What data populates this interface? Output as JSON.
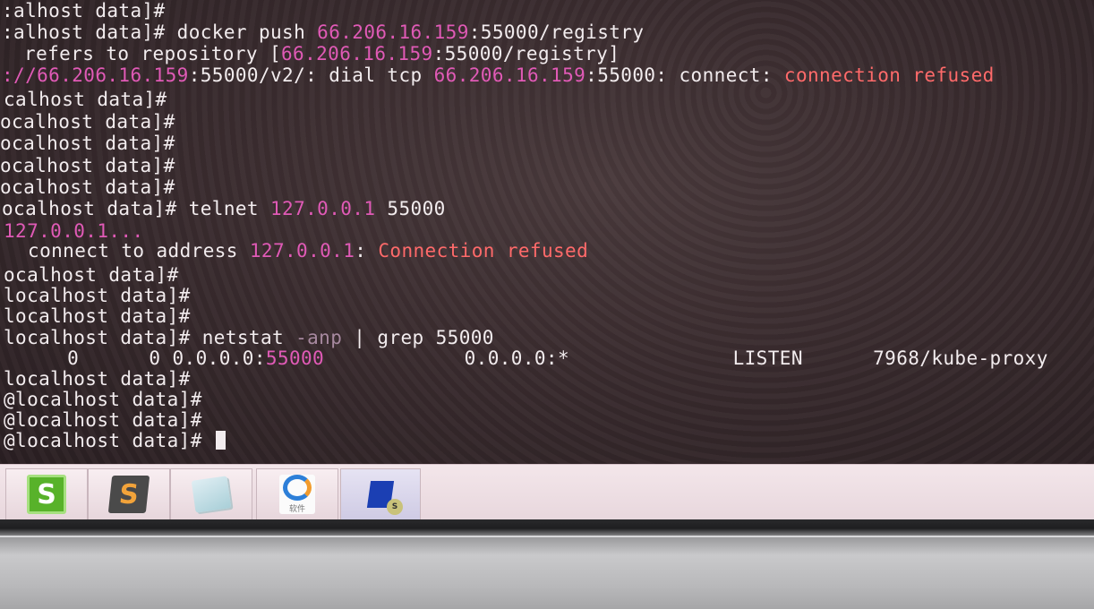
{
  "terminal": {
    "lines": [
      [
        {
          "t": ":alhost data]#",
          "c": ""
        }
      ],
      [
        {
          "t": ":alhost data]# docker push ",
          "c": ""
        },
        {
          "t": "66.206.16.159",
          "c": "mag"
        },
        {
          "t": ":55000/registry",
          "c": ""
        }
      ],
      [
        {
          "t": " refers to repository [",
          "c": ""
        },
        {
          "t": "66.206.16.159",
          "c": "mag"
        },
        {
          "t": ":55000/registry]",
          "c": ""
        }
      ],
      [
        {
          "t": "://66.206.16.159",
          "c": "mag"
        },
        {
          "t": ":55000/v2/: dial tcp ",
          "c": ""
        },
        {
          "t": "66.206.16.159",
          "c": "mag"
        },
        {
          "t": ":55000: connect: ",
          "c": ""
        },
        {
          "t": "connection refused",
          "c": "red"
        }
      ],
      [
        {
          "t": "calhost data]#",
          "c": ""
        }
      ],
      [
        {
          "t": "ocalhost data]#",
          "c": ""
        }
      ],
      [
        {
          "t": "ocalhost data]#",
          "c": ""
        }
      ],
      [
        {
          "t": "ocalhost data]#",
          "c": ""
        }
      ],
      [
        {
          "t": "ocalhost data]#",
          "c": ""
        }
      ],
      [
        {
          "t": "ocalhost data]# telnet ",
          "c": ""
        },
        {
          "t": "127.0.0.1",
          "c": "mag"
        },
        {
          "t": " 55000",
          "c": ""
        }
      ],
      [
        {
          "t": "127.0.0.1...",
          "c": "mag"
        }
      ],
      [
        {
          "t": " connect to address ",
          "c": ""
        },
        {
          "t": "127.0.0.1",
          "c": "mag"
        },
        {
          "t": ": ",
          "c": ""
        },
        {
          "t": "Connection refused",
          "c": "red"
        }
      ],
      [
        {
          "t": "ocalhost data]#",
          "c": ""
        }
      ],
      [
        {
          "t": "localhost data]#",
          "c": ""
        }
      ],
      [
        {
          "t": "localhost data]#",
          "c": ""
        }
      ],
      [
        {
          "t": "localhost data]# netstat ",
          "c": ""
        },
        {
          "t": "-anp",
          "c": "dim"
        },
        {
          "t": " | grep 55000",
          "c": ""
        }
      ],
      [
        {
          "t": "   0      0 0.0.0.0:",
          "c": ""
        },
        {
          "t": "55000",
          "c": "mag"
        },
        {
          "t": "            0.0.0.0:*              LISTEN      7968/kube-proxy",
          "c": ""
        }
      ],
      [
        {
          "t": "localhost data]#",
          "c": ""
        }
      ],
      [
        {
          "t": "@localhost data]#",
          "c": ""
        }
      ],
      [
        {
          "t": "@localhost data]#",
          "c": ""
        }
      ],
      [
        {
          "t": "@localhost data]# ",
          "c": ""
        }
      ]
    ]
  },
  "taskbar": {
    "items": [
      {
        "name": "green-s-app-icon",
        "glyph": "S"
      },
      {
        "name": "sublime-text-icon",
        "glyph": "S"
      },
      {
        "name": "notes-app-icon",
        "glyph": ""
      },
      {
        "name": "app-shortcut-icon",
        "glyph": "",
        "caption": "软件"
      },
      {
        "name": "ssh-client-icon",
        "glyph": "",
        "badge": "S"
      }
    ]
  }
}
